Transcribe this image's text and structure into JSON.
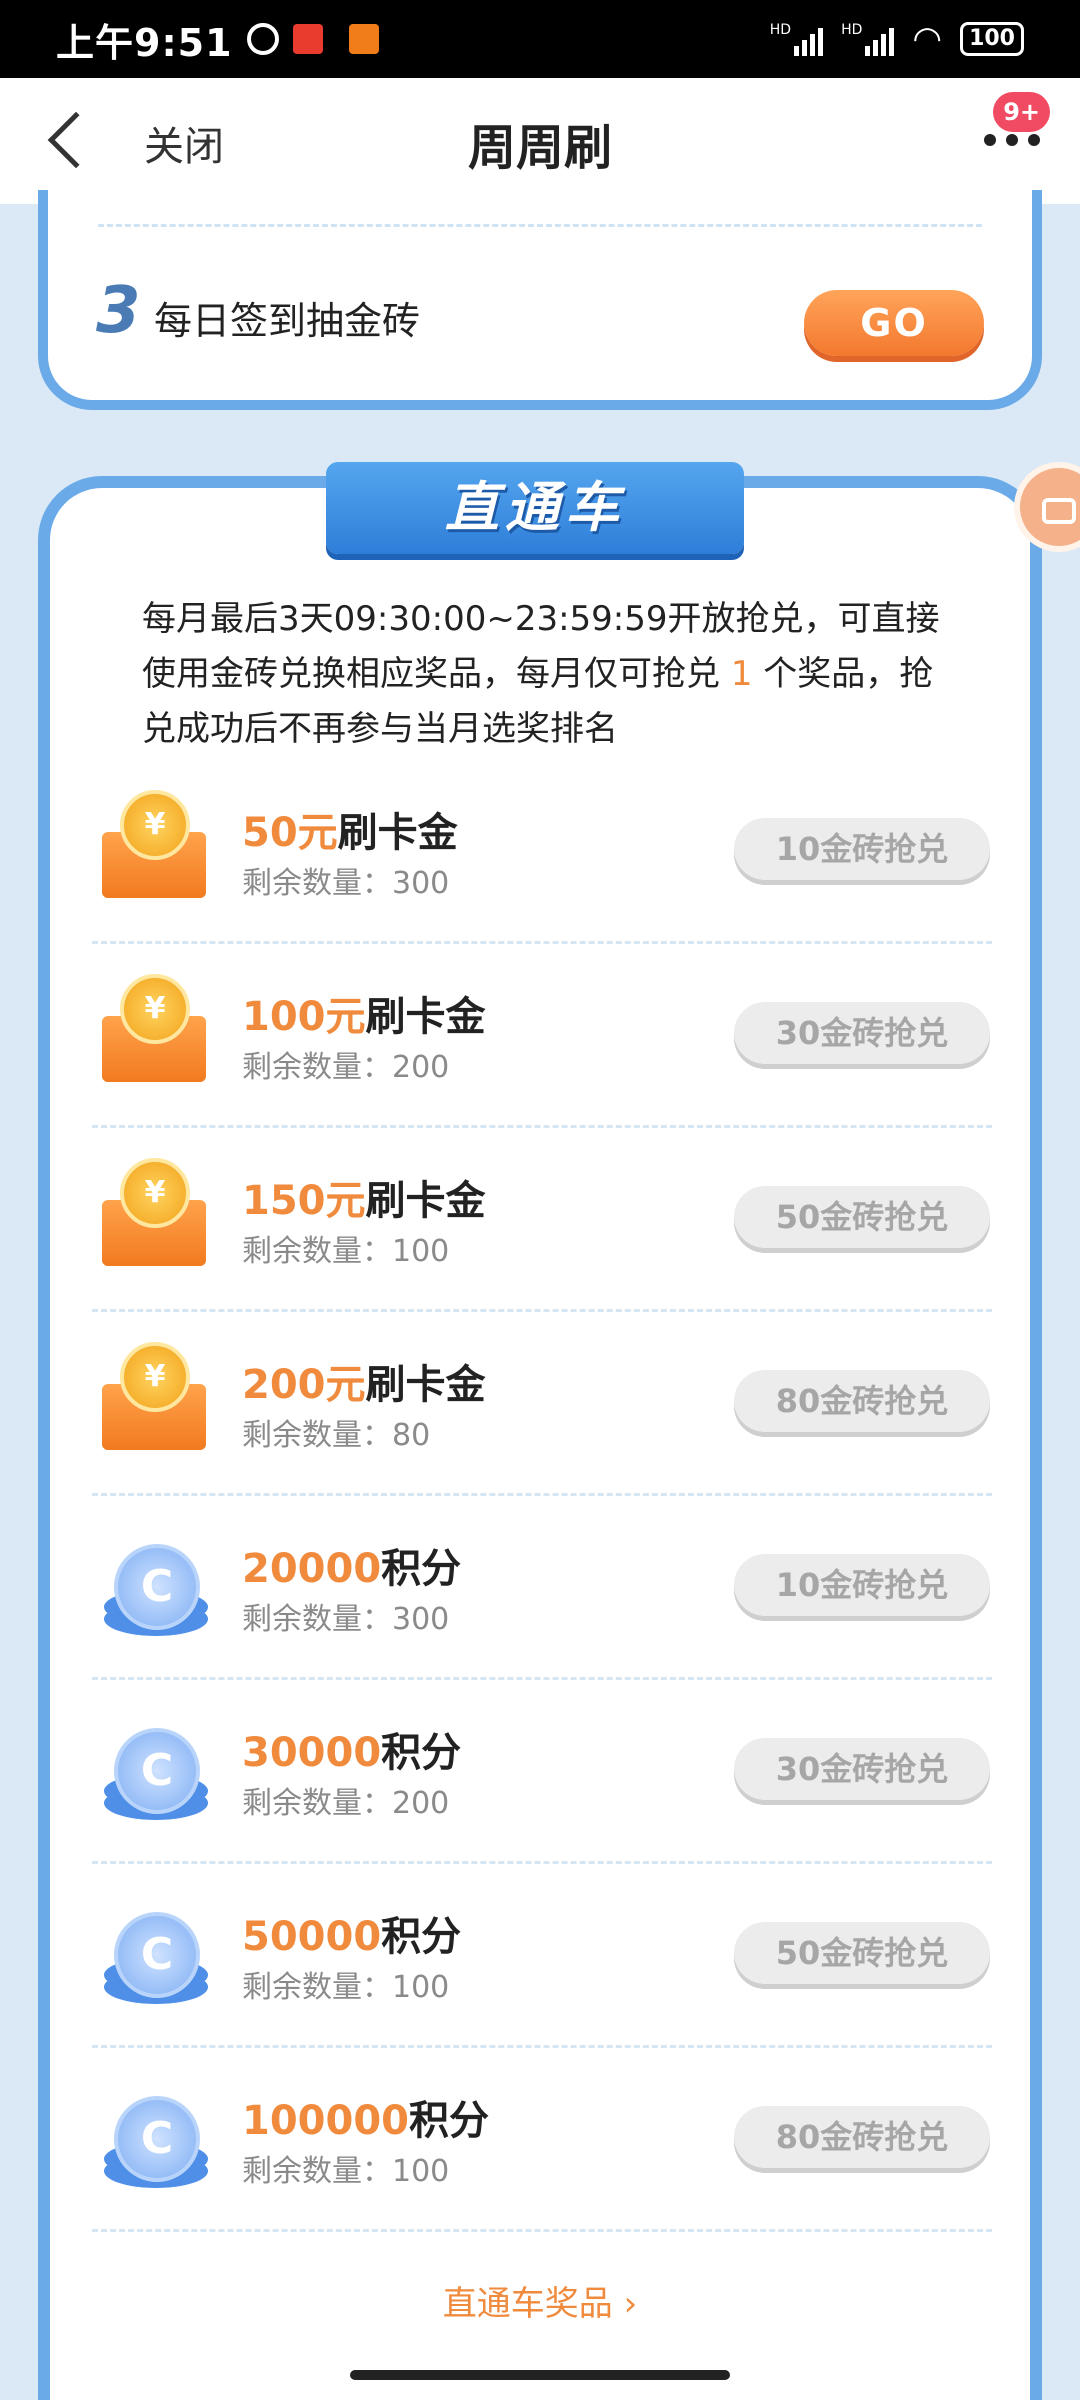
{
  "status_bar": {
    "time": "上午9:51",
    "signal1": "HD",
    "signal2": "HD",
    "battery": "100"
  },
  "titlebar": {
    "close_label": "关闭",
    "title": "周周刷",
    "badge": "9+"
  },
  "task": {
    "number": "3",
    "label": "每日签到抽金砖",
    "go_label": "GO"
  },
  "section": {
    "banner": "直通车",
    "desc_before": "每月最后3天09:30:00~23:59:59开放抢兑，可直接使用金砖兑换相应奖品，每月仅可抢兑 ",
    "desc_highlight": "1",
    "desc_after": " 个奖品，抢兑成功后不再参与当月选奖排名"
  },
  "items": [
    {
      "icon": "gift-coin-icon",
      "amount": "50元",
      "suffix": "刷卡金",
      "stock": "剩余数量：300",
      "button": "10金砖抢兑"
    },
    {
      "icon": "gift-coin-icon",
      "amount": "100元",
      "suffix": "刷卡金",
      "stock": "剩余数量：200",
      "button": "30金砖抢兑"
    },
    {
      "icon": "gift-coin-icon",
      "amount": "150元",
      "suffix": "刷卡金",
      "stock": "剩余数量：100",
      "button": "50金砖抢兑"
    },
    {
      "icon": "gift-coin-icon",
      "amount": "200元",
      "suffix": "刷卡金",
      "stock": "剩余数量：80",
      "button": "80金砖抢兑"
    },
    {
      "icon": "points-coin-icon",
      "amount": "20000",
      "suffix": "积分",
      "stock": "剩余数量：300",
      "button": "10金砖抢兑"
    },
    {
      "icon": "points-coin-icon",
      "amount": "30000",
      "suffix": "积分",
      "stock": "剩余数量：200",
      "button": "30金砖抢兑"
    },
    {
      "icon": "points-coin-icon",
      "amount": "50000",
      "suffix": "积分",
      "stock": "剩余数量：100",
      "button": "50金砖抢兑"
    },
    {
      "icon": "points-coin-icon",
      "amount": "100000",
      "suffix": "积分",
      "stock": "剩余数量：100",
      "button": "80金砖抢兑"
    }
  ],
  "footer": {
    "prize_link": "直通车奖品 ›"
  },
  "colors": {
    "accent_orange": "#f08a3c",
    "card_border_blue": "#6aaae8",
    "page_bg": "#dbe9f6"
  }
}
